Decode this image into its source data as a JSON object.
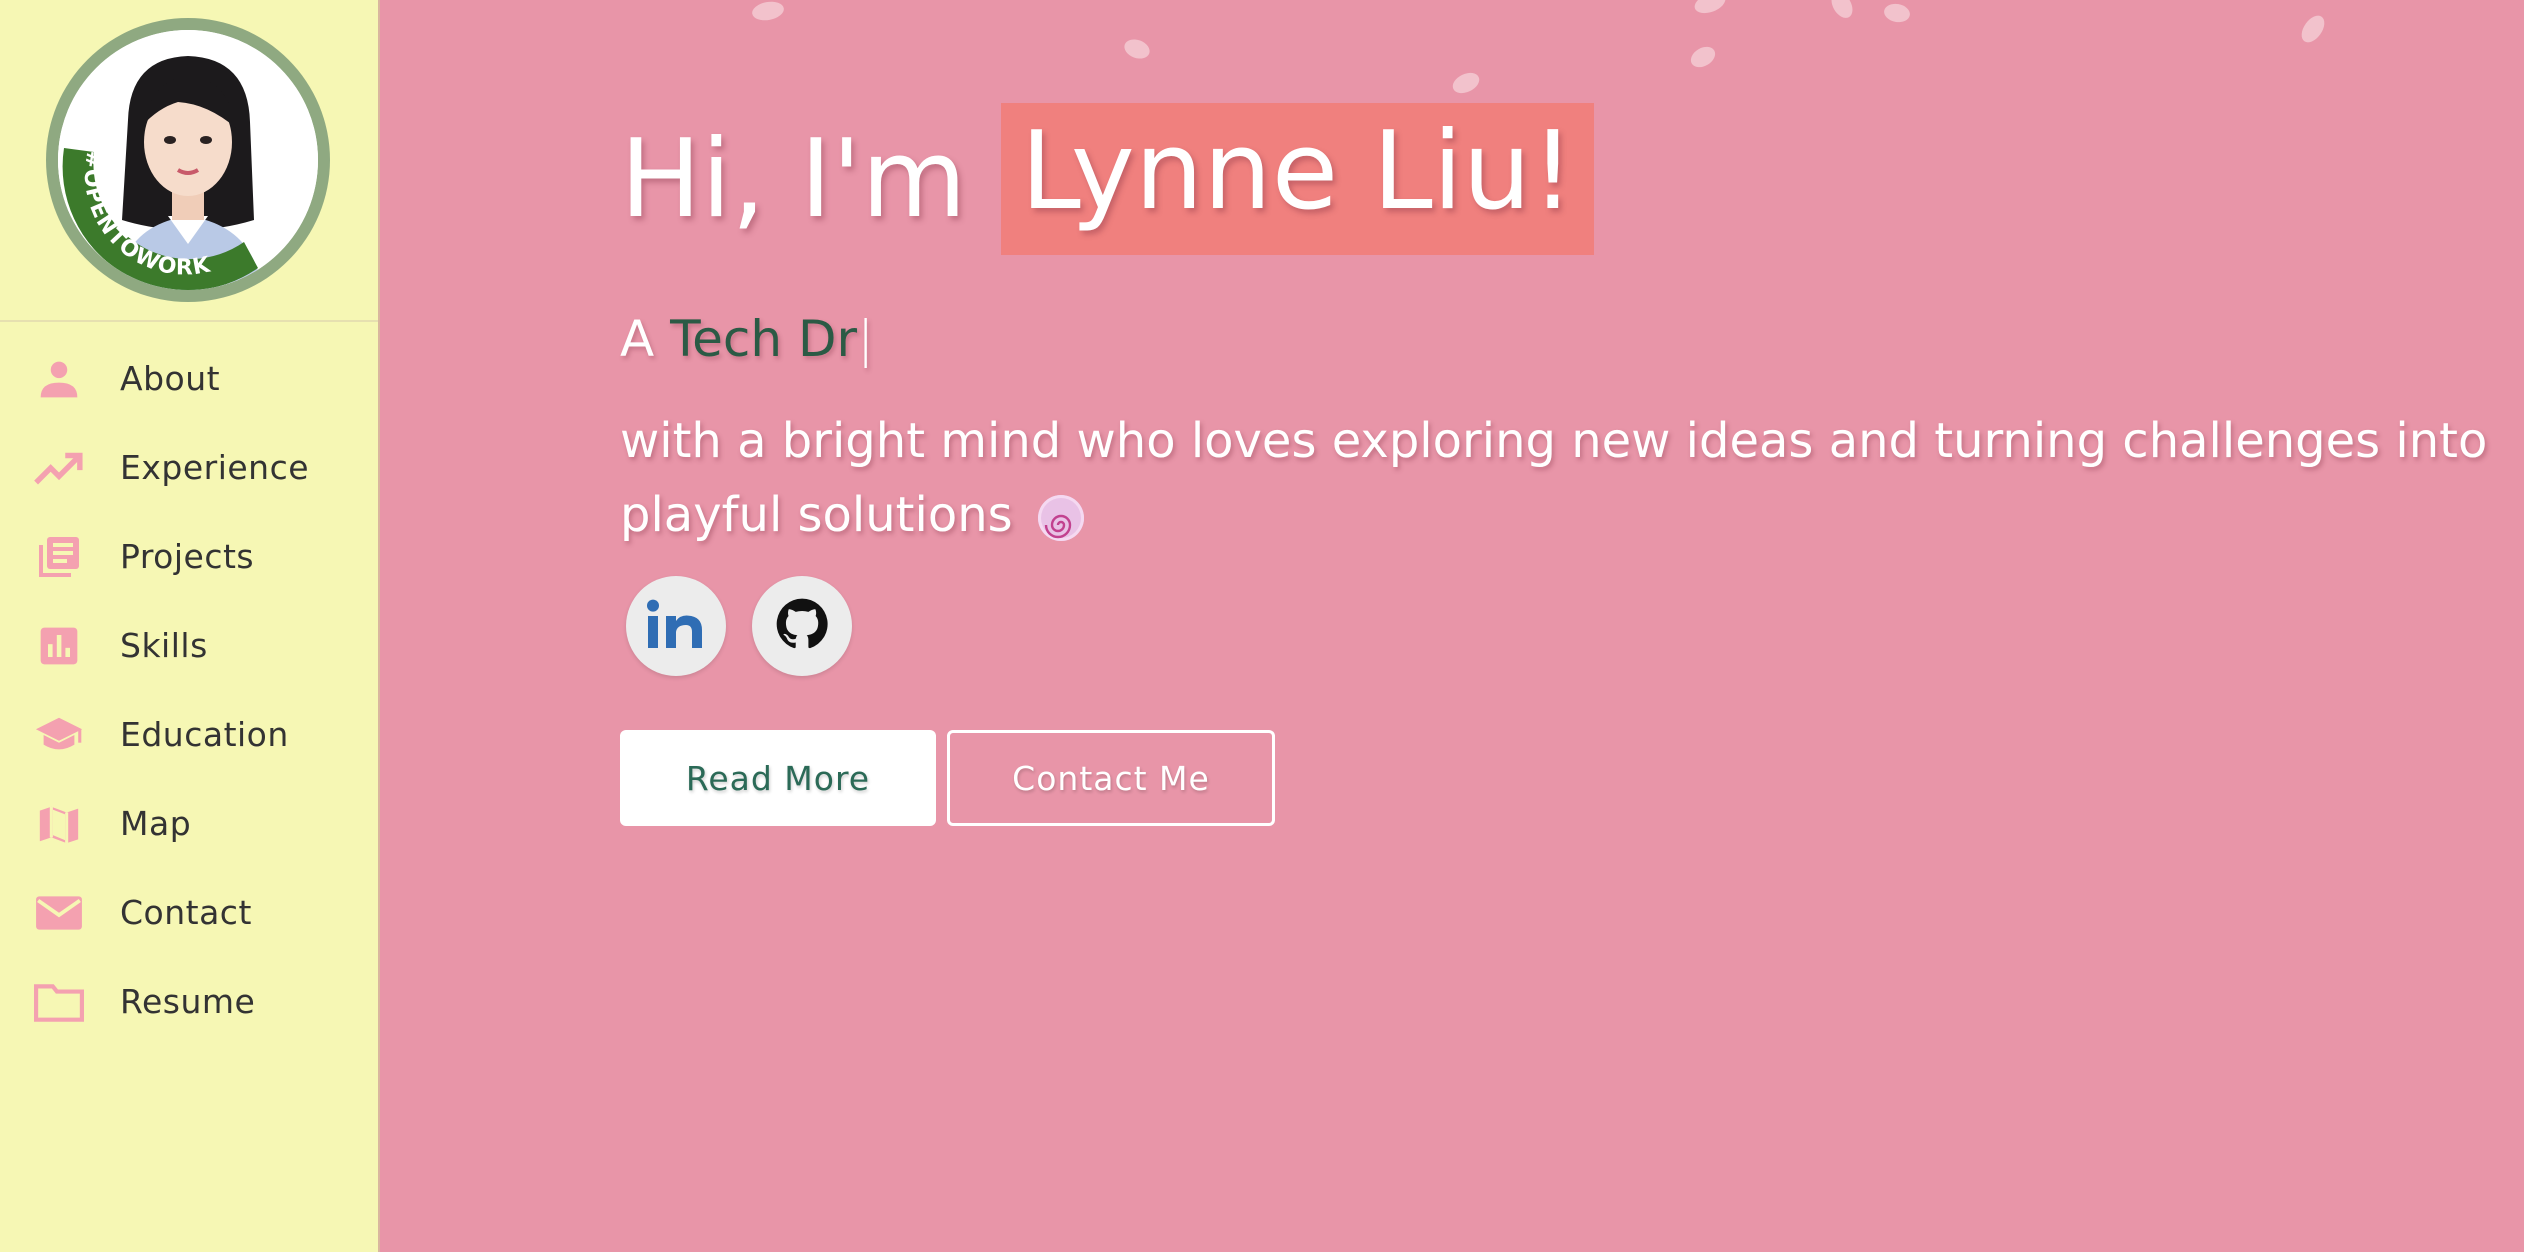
{
  "profile": {
    "badge_text": "#OPENTOWORK"
  },
  "nav": {
    "items": [
      {
        "label": "About",
        "icon": "person-icon"
      },
      {
        "label": "Experience",
        "icon": "trending-up-icon"
      },
      {
        "label": "Projects",
        "icon": "library-books-icon"
      },
      {
        "label": "Skills",
        "icon": "bar-chart-icon"
      },
      {
        "label": "Education",
        "icon": "school-icon"
      },
      {
        "label": "Map",
        "icon": "map-icon"
      },
      {
        "label": "Contact",
        "icon": "mail-icon"
      },
      {
        "label": "Resume",
        "icon": "folder-icon"
      }
    ]
  },
  "hero": {
    "greeting": "Hi, I'm",
    "name": "Lynne Liu!",
    "tagline_prefix": "A",
    "tagline_typed": "Tech Dr",
    "tagline_cursor": "|",
    "description": "with a bright mind who loves exploring new ideas and turning challenges into playful solutions"
  },
  "socials": [
    {
      "name": "linkedin",
      "icon": "linkedin-icon"
    },
    {
      "name": "github",
      "icon": "github-icon"
    }
  ],
  "buttons": {
    "read_more": "Read More",
    "contact_me": "Contact Me"
  },
  "colors": {
    "sidebar_bg": "#f6f7b4",
    "main_bg": "#e895a8",
    "accent_pink": "#f0807e",
    "icon_pink": "#f4a1b0",
    "typed_text": "#2b5a45"
  }
}
